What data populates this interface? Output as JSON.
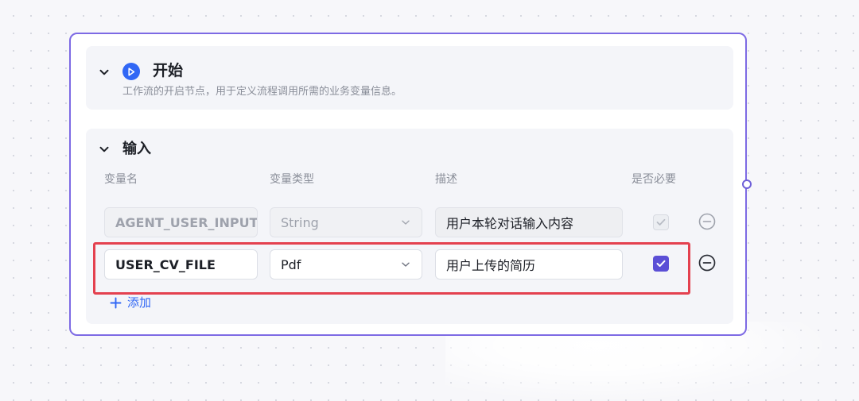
{
  "start_node": {
    "title": "开始",
    "description": "工作流的开启节点，用于定义流程调用所需的业务变量信息。",
    "icon": "play-icon",
    "accent_color": "#3167f5",
    "border_color": "#7d6ae4"
  },
  "inputs": {
    "title": "输入",
    "columns": {
      "name": "变量名",
      "type": "变量类型",
      "description": "描述",
      "required": "是否必要"
    },
    "rows": [
      {
        "name": "AGENT_USER_INPUT",
        "type": "String",
        "description": "用户本轮对话输入内容",
        "required": true,
        "disabled": true
      },
      {
        "name": "USER_CV_FILE",
        "type": "Pdf",
        "description": "用户上传的简历",
        "required": true,
        "disabled": false
      }
    ],
    "add_label": "添加"
  },
  "highlight_color": "#e4414f",
  "checkbox_color": "#5b4fd6"
}
